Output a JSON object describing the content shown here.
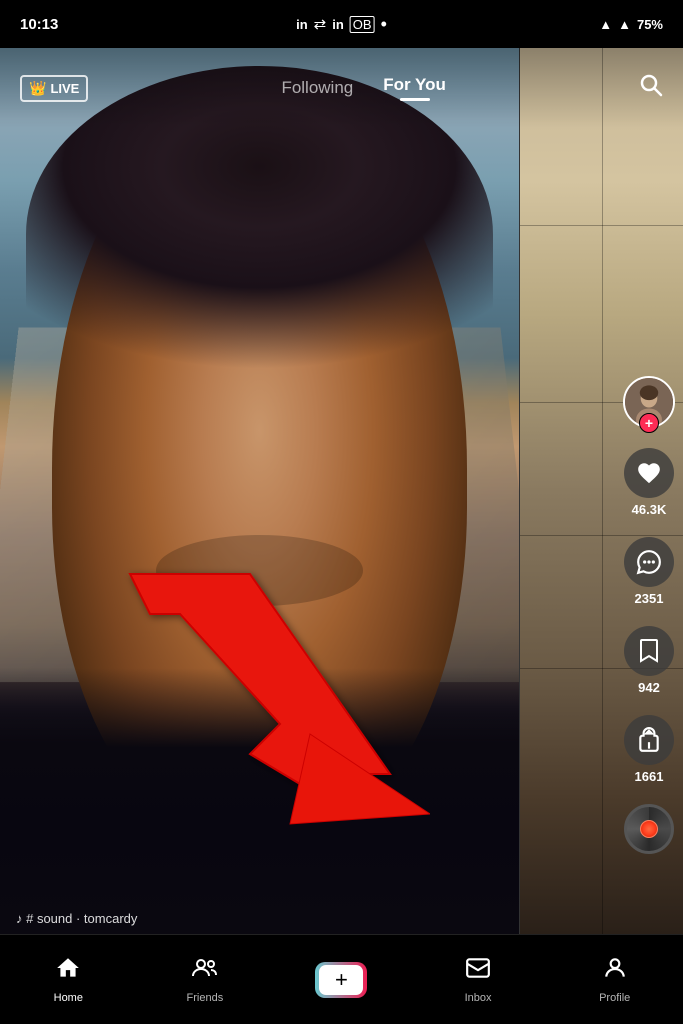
{
  "status_bar": {
    "time": "10:13",
    "battery": "75%",
    "signal": "●"
  },
  "nav": {
    "live_label": "LIVE",
    "following_label": "Following",
    "foryou_label": "For You",
    "active_tab": "foryou"
  },
  "sidebar": {
    "like_count": "46.3K",
    "comment_count": "2351",
    "bookmark_count": "942",
    "share_count": "1661"
  },
  "sound": {
    "text": "♪ # sound · tomcardy"
  },
  "bottom_nav": {
    "home_label": "Home",
    "friends_label": "Friends",
    "inbox_label": "Inbox",
    "profile_label": "Profile"
  }
}
